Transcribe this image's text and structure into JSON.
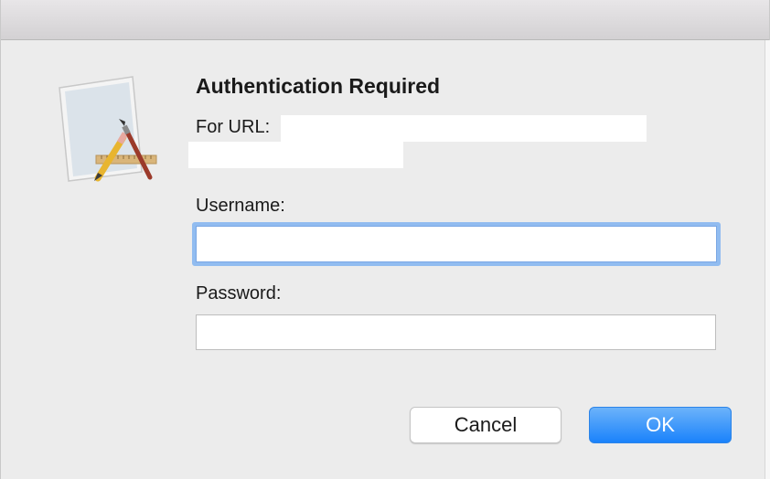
{
  "dialog": {
    "title": "Authentication Required",
    "url_label": "For URL:",
    "icon": "script-editor-icon"
  },
  "form": {
    "username_label": "Username:",
    "username_value": "",
    "password_label": "Password:",
    "password_value": ""
  },
  "buttons": {
    "cancel": "Cancel",
    "ok": "OK"
  },
  "colors": {
    "accent": "#1a82fb",
    "focus_ring": "#91bcf0",
    "background": "#ececec"
  }
}
